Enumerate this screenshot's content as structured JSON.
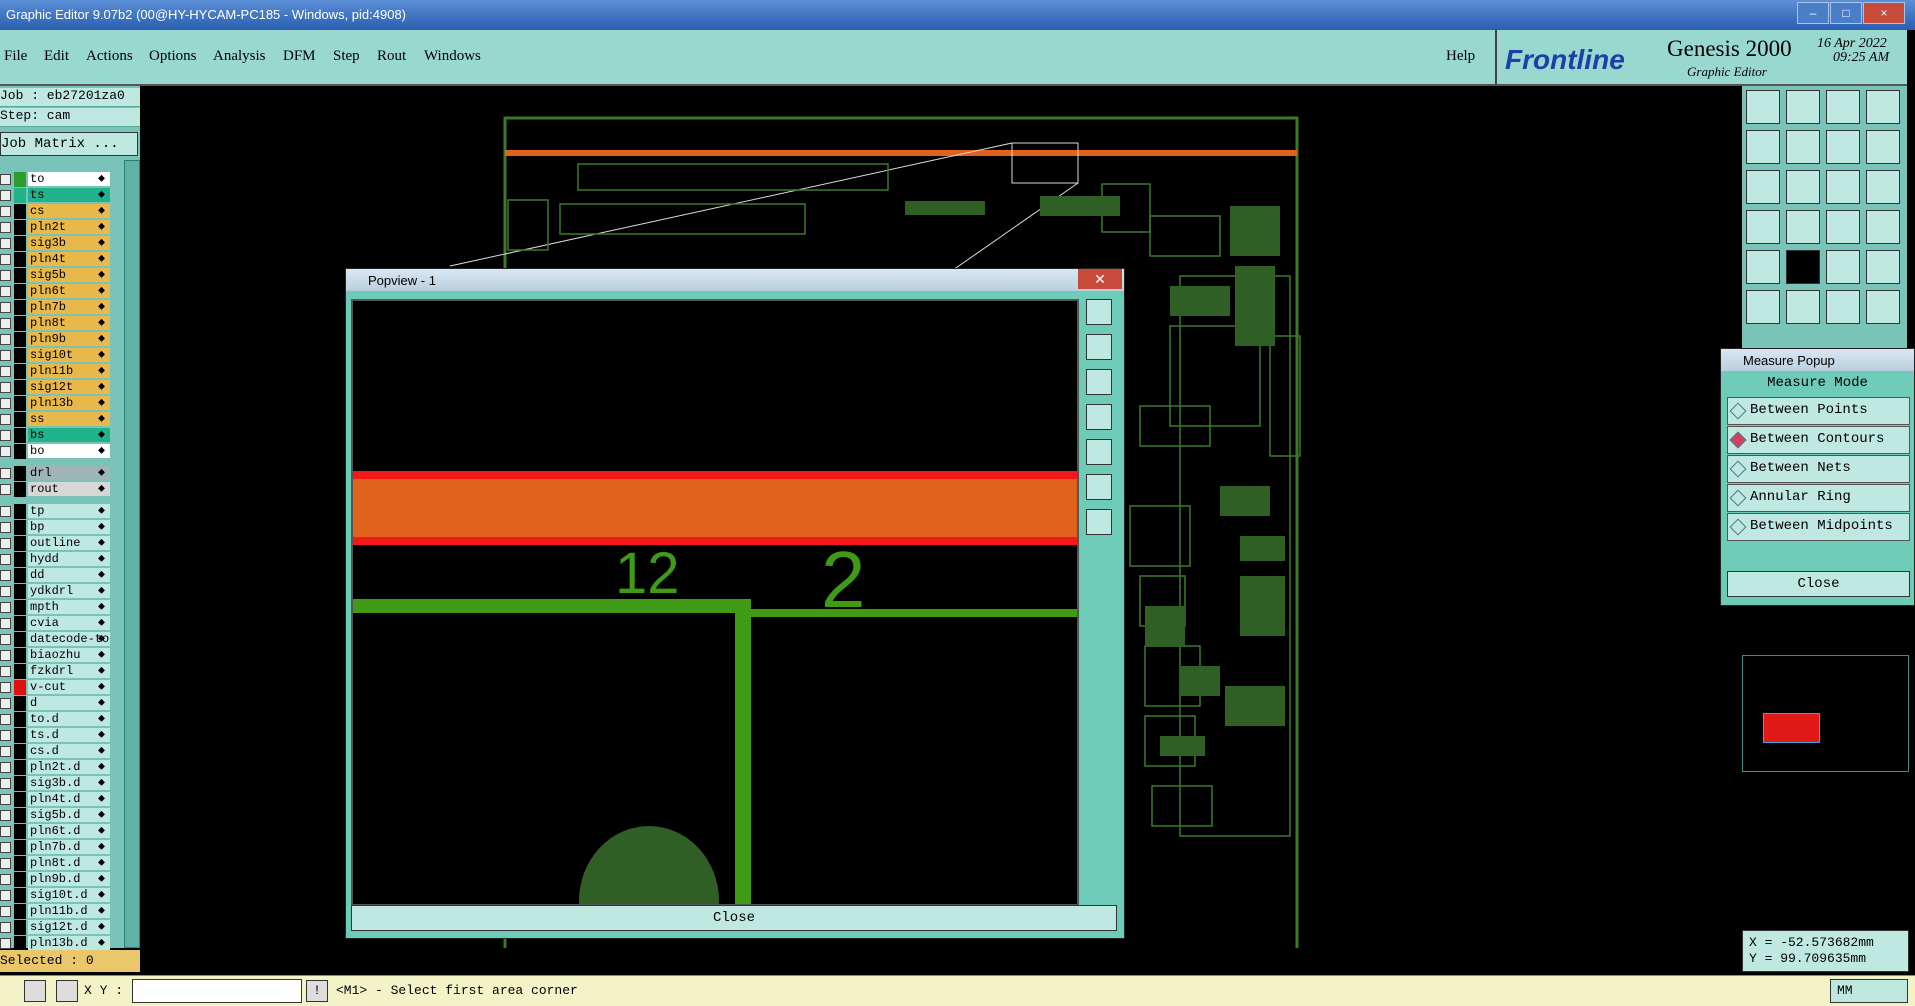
{
  "window": {
    "title": "Graphic Editor 9.07b2 (00@HY-HYCAM-PC185 - Windows, pid:4908)",
    "minimize": "–",
    "maximize": "□",
    "close": "×"
  },
  "menu": {
    "items": [
      "File",
      "Edit",
      "Actions",
      "Options",
      "Analysis",
      "DFM",
      "Step",
      "Rout",
      "Windows"
    ],
    "help": "Help"
  },
  "logo": {
    "brand": "Frontline",
    "product": "Genesis 2000",
    "subtitle": "Graphic Editor",
    "date": "16 Apr 2022",
    "time": "09:25 AM"
  },
  "left": {
    "job": "Job : eb27201za0",
    "step": "Step: cam",
    "matrix_button": "Job Matrix ...",
    "layers": [
      {
        "name": "to",
        "color": "#ffffff",
        "sw": "#2a9d2a"
      },
      {
        "name": "ts",
        "color": "#20b28a",
        "sw": "#20b28a"
      },
      {
        "name": "cs",
        "color": "#e8b84a",
        "sw": "#000000"
      },
      {
        "name": "pln2t",
        "color": "#e8b84a",
        "sw": "#000000"
      },
      {
        "name": "sig3b",
        "color": "#e8b84a",
        "sw": "#000000"
      },
      {
        "name": "pln4t",
        "color": "#e8b84a",
        "sw": "#000000"
      },
      {
        "name": "sig5b",
        "color": "#e8b84a",
        "sw": "#000000"
      },
      {
        "name": "pln6t",
        "color": "#e8b84a",
        "sw": "#000000"
      },
      {
        "name": "pln7b",
        "color": "#e8b84a",
        "sw": "#000000"
      },
      {
        "name": "pln8t",
        "color": "#e8b84a",
        "sw": "#000000"
      },
      {
        "name": "pln9b",
        "color": "#e8b84a",
        "sw": "#000000"
      },
      {
        "name": "sig10t",
        "color": "#e8b84a",
        "sw": "#000000"
      },
      {
        "name": "pln11b",
        "color": "#e8b84a",
        "sw": "#000000"
      },
      {
        "name": "sig12t",
        "color": "#e8b84a",
        "sw": "#000000"
      },
      {
        "name": "pln13b",
        "color": "#e8b84a",
        "sw": "#000000"
      },
      {
        "name": "ss",
        "color": "#e8b84a",
        "sw": "#000000"
      },
      {
        "name": "bs",
        "color": "#20b28a",
        "sw": "#000000"
      },
      {
        "name": "bo",
        "color": "#ffffff",
        "sw": "#000000"
      },
      {
        "name": "drl",
        "color": "#9fb5b5",
        "sw": "#000000"
      },
      {
        "name": "rout",
        "color": "#d7d7d7",
        "sw": "#000000"
      },
      {
        "name": "tp",
        "color": "#bfe8e1",
        "sw": "#000000"
      },
      {
        "name": "bp",
        "color": "#bfe8e1",
        "sw": "#000000"
      },
      {
        "name": "outline",
        "color": "#bfe8e1",
        "sw": "#000000"
      },
      {
        "name": "hydd",
        "color": "#bfe8e1",
        "sw": "#000000"
      },
      {
        "name": "dd",
        "color": "#bfe8e1",
        "sw": "#000000"
      },
      {
        "name": "ydkdrl",
        "color": "#bfe8e1",
        "sw": "#000000"
      },
      {
        "name": "mpth",
        "color": "#bfe8e1",
        "sw": "#000000"
      },
      {
        "name": "cvia",
        "color": "#bfe8e1",
        "sw": "#000000"
      },
      {
        "name": "datecode-to",
        "color": "#bfe8e1",
        "sw": "#000000"
      },
      {
        "name": "biaozhu",
        "color": "#bfe8e1",
        "sw": "#000000"
      },
      {
        "name": "fzkdrl",
        "color": "#bfe8e1",
        "sw": "#000000"
      },
      {
        "name": "v-cut",
        "color": "#bfe8e1",
        "sw": "#e01010"
      },
      {
        "name": "d",
        "color": "#bfe8e1",
        "sw": "#000000"
      },
      {
        "name": "to.d",
        "color": "#bfe8e1",
        "sw": "#000000"
      },
      {
        "name": "ts.d",
        "color": "#bfe8e1",
        "sw": "#000000"
      },
      {
        "name": "cs.d",
        "color": "#bfe8e1",
        "sw": "#000000"
      },
      {
        "name": "pln2t.d",
        "color": "#bfe8e1",
        "sw": "#000000"
      },
      {
        "name": "sig3b.d",
        "color": "#bfe8e1",
        "sw": "#000000"
      },
      {
        "name": "pln4t.d",
        "color": "#bfe8e1",
        "sw": "#000000"
      },
      {
        "name": "sig5b.d",
        "color": "#bfe8e1",
        "sw": "#000000"
      },
      {
        "name": "pln6t.d",
        "color": "#bfe8e1",
        "sw": "#000000"
      },
      {
        "name": "pln7b.d",
        "color": "#bfe8e1",
        "sw": "#000000"
      },
      {
        "name": "pln8t.d",
        "color": "#bfe8e1",
        "sw": "#000000"
      },
      {
        "name": "pln9b.d",
        "color": "#bfe8e1",
        "sw": "#000000"
      },
      {
        "name": "sig10t.d",
        "color": "#bfe8e1",
        "sw": "#000000"
      },
      {
        "name": "pln11b.d",
        "color": "#bfe8e1",
        "sw": "#000000"
      },
      {
        "name": "sig12t.d",
        "color": "#bfe8e1",
        "sw": "#000000"
      },
      {
        "name": "pln13b.d",
        "color": "#bfe8e1",
        "sw": "#000000"
      }
    ],
    "selected": "Selected : 0"
  },
  "popview": {
    "title": "Popview - 1",
    "label_a": "12",
    "label_b": "2",
    "close": "Close"
  },
  "measure": {
    "title": "Measure Popup",
    "heading": "Measure Mode",
    "options": [
      "Between Points",
      "Between Contours",
      "Between Nets",
      "Annular Ring",
      "Between Midpoints"
    ],
    "selected_index": 1,
    "close": "Close"
  },
  "coords": {
    "x": "X = -52.573682mm",
    "y": "Y = 99.709635mm"
  },
  "status": {
    "xy_label": "X Y :",
    "xy_value": "",
    "message": "<M1> - Select first area corner",
    "units": "MM"
  },
  "colors": {
    "panel": "#78c4b8",
    "accent_green": "#3f9a16",
    "accent_orange": "#e0621c",
    "pcb_outline": "#3c7a2a"
  }
}
